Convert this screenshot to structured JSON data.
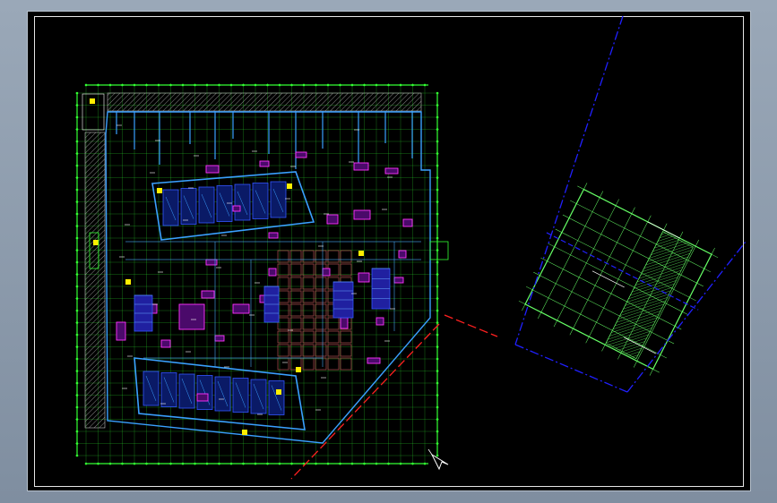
{
  "canvas": {
    "background": "#000000",
    "frame_color": "#e6e6e6",
    "colors": {
      "grid": "#33ff33",
      "wall": "#3aa0ff",
      "room": "#ff33ff",
      "fixture": "#3355ff",
      "text": "#ffffff",
      "property_line_red": "#ff2020",
      "property_line_blue": "#2020ff",
      "annex_grid": "#66ff66"
    }
  },
  "icons": {
    "cursor": "arrow-cursor-icon",
    "north": "ucs-icon"
  }
}
